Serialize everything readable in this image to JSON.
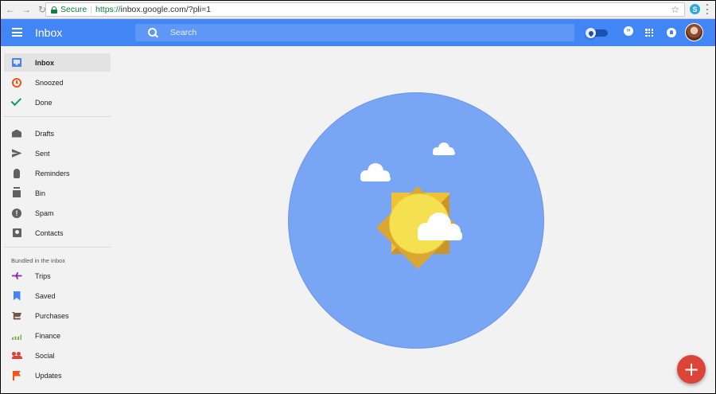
{
  "browser": {
    "secure_label": "Secure",
    "url_scheme": "https://",
    "url_host_path": "inbox.google.com/?pli=1",
    "icons": [
      "back-icon",
      "forward-icon",
      "reload-icon",
      "lock-icon",
      "star-icon",
      "skype-extension-icon",
      "more-vert-icon"
    ]
  },
  "header": {
    "title": "Inbox",
    "search_placeholder": "Search",
    "icons": [
      "menu-icon",
      "search-icon",
      "pin-toggle-icon",
      "hangouts-icon",
      "apps-icon",
      "notifications-icon",
      "avatar"
    ]
  },
  "sidebar": {
    "primary": [
      {
        "label": "Inbox",
        "icon": "inbox-icon",
        "active": true
      },
      {
        "label": "Snoozed",
        "icon": "snooze-icon"
      },
      {
        "label": "Done",
        "icon": "check-icon"
      }
    ],
    "secondary": [
      {
        "label": "Drafts",
        "icon": "drafts-icon"
      },
      {
        "label": "Sent",
        "icon": "send-icon"
      },
      {
        "label": "Reminders",
        "icon": "reminder-icon"
      },
      {
        "label": "Bin",
        "icon": "trash-icon"
      },
      {
        "label": "Spam",
        "icon": "spam-icon"
      },
      {
        "label": "Contacts",
        "icon": "contacts-icon"
      }
    ],
    "bundles_heading": "Bundled in the inbox",
    "bundles": [
      {
        "label": "Trips",
        "icon": "plane-icon"
      },
      {
        "label": "Saved",
        "icon": "bookmark-icon"
      },
      {
        "label": "Purchases",
        "icon": "cart-icon"
      },
      {
        "label": "Finance",
        "icon": "finance-icon"
      },
      {
        "label": "Social",
        "icon": "people-icon"
      },
      {
        "label": "Updates",
        "icon": "flag-icon"
      }
    ]
  },
  "fab": {
    "label": "+",
    "icon": "compose-plus-icon"
  },
  "colors": {
    "brand_blue": "#4285f4",
    "sky_blue": "#78a6f5",
    "sun_yellow": "#f5e050",
    "fab_red": "#db4437",
    "background": "#f2f2f2"
  }
}
